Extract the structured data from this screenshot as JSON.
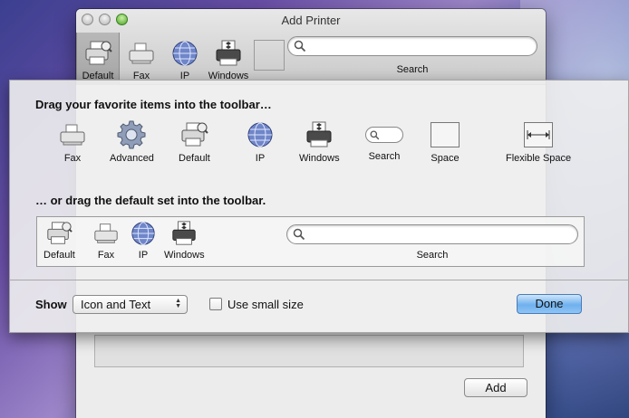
{
  "window": {
    "title": "Add Printer",
    "toolbar": [
      {
        "label": "Default",
        "icon": "default-printer-icon",
        "selected": true
      },
      {
        "label": "Fax",
        "icon": "fax-icon"
      },
      {
        "label": "IP",
        "icon": "ip-globe-icon"
      },
      {
        "label": "Windows",
        "icon": "windows-printer-icon"
      }
    ],
    "search_label": "Search",
    "add_button": "Add"
  },
  "sheet": {
    "heading_palette": "Drag your favorite items into the toolbar…",
    "palette": [
      {
        "label": "Fax",
        "icon": "fax-icon"
      },
      {
        "label": "Advanced",
        "icon": "gear-icon"
      },
      {
        "label": "Default",
        "icon": "default-printer-icon"
      },
      {
        "label": "IP",
        "icon": "ip-globe-icon"
      },
      {
        "label": "Windows",
        "icon": "windows-printer-icon"
      },
      {
        "label": "Search",
        "icon": "search-field-icon"
      },
      {
        "label": "Space",
        "icon": "space-icon"
      },
      {
        "label": "Flexible Space",
        "icon": "flexible-space-icon"
      }
    ],
    "heading_default": "… or drag the default set into the toolbar.",
    "default_set": [
      {
        "label": "Default",
        "icon": "default-printer-icon"
      },
      {
        "label": "Fax",
        "icon": "fax-icon"
      },
      {
        "label": "IP",
        "icon": "ip-globe-icon"
      },
      {
        "label": "Windows",
        "icon": "windows-printer-icon"
      }
    ],
    "default_search_label": "Search",
    "show_label": "Show",
    "show_value": "Icon and Text",
    "small_size_label": "Use small size",
    "small_size_checked": false,
    "done_label": "Done"
  },
  "colors": {
    "done_accent": "#6fb1ee",
    "window_bg": "#ececec"
  }
}
